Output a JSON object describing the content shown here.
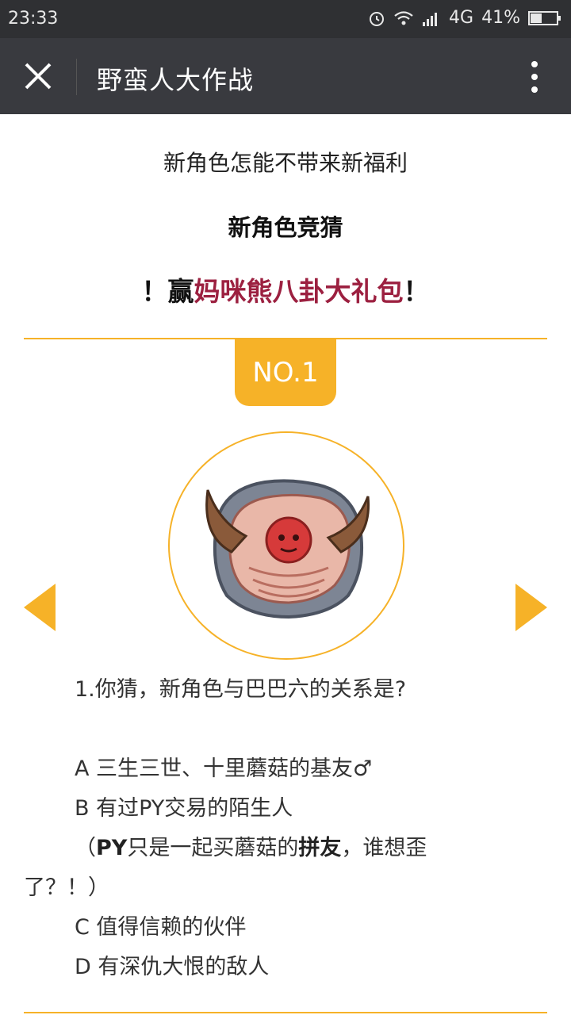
{
  "status": {
    "time": "23:33",
    "network": "4G",
    "battery": "41%"
  },
  "nav": {
    "title": "野蛮人大作战"
  },
  "intro": {
    "line1": "新角色怎能不带来新福利",
    "line2": "新角色竞猜",
    "line3_prefix": "！赢",
    "line3_highlight": "妈咪熊八卦大礼包",
    "line3_suffix": "！"
  },
  "badge": "NO.1",
  "question": {
    "text": "1.你猜，新角色与巴巴六的关系是?",
    "option_a": "A 三生三世、十里蘑菇的基友♂",
    "option_b": "B 有过PY交易的陌生人",
    "note_open": "（",
    "note_py": "PY",
    "note_mid": "只是一起买蘑菇的",
    "note_bold": "拼友",
    "note_end": "，谁想歪",
    "note_line2": "了？！）",
    "option_c": "C 值得信赖的伙伴",
    "option_d": "D 有深仇大恨的敌人"
  },
  "colors": {
    "accent": "#f6b228",
    "highlight": "#9c2040",
    "topbar": "#393a3f",
    "statusbar": "#2f3033"
  }
}
